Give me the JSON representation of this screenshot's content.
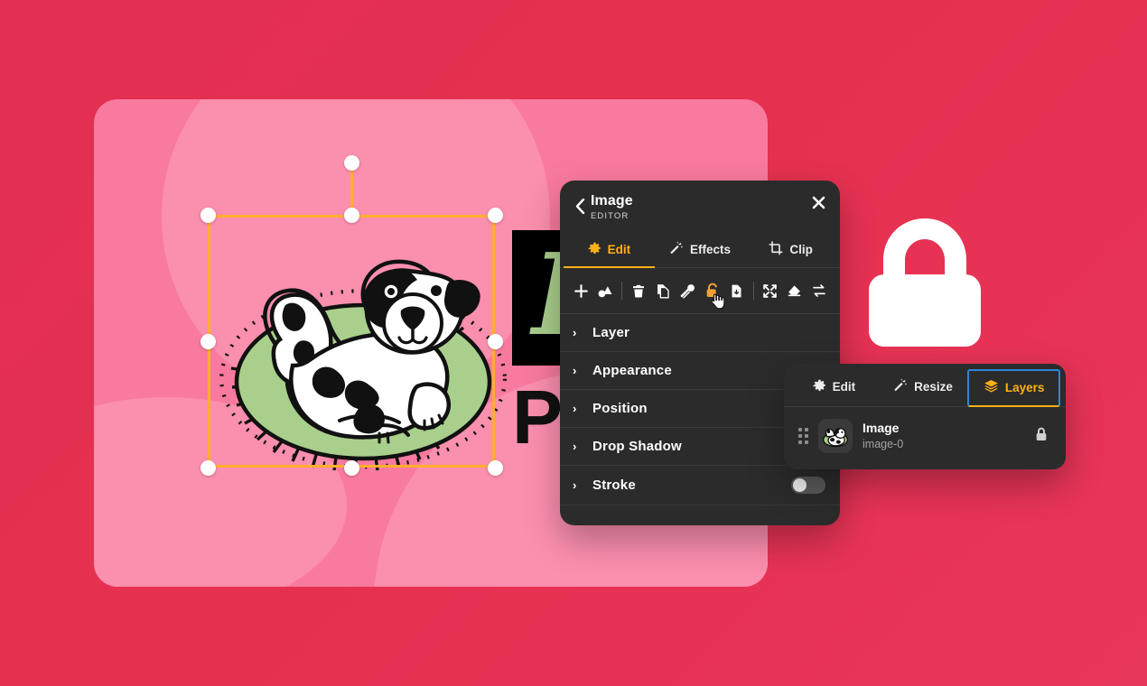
{
  "colors": {
    "backdrop": "#e6304f",
    "canvas_card": "#f97a9f",
    "canvas_blob": "#fb8fae",
    "panel_bg": "#2b2b2b",
    "accent_orange": "#ffb114",
    "selection_orange": "#ffae2e",
    "focus_blue": "#2e86d8",
    "rug_green": "#a9cf8c",
    "lock_white": "#ffffff"
  },
  "canvas": {
    "logo_letter": "B",
    "logo_subletter": "P",
    "artwork_name": "dog-on-rug-illustration"
  },
  "editor": {
    "title": "Image",
    "subtitle": "EDITOR",
    "back_icon": "chevron-left-icon",
    "close_icon": "close-icon",
    "tabs": [
      {
        "label": "Edit",
        "icon": "gear-icon",
        "active": true
      },
      {
        "label": "Effects",
        "icon": "magic-wand-icon",
        "active": false
      },
      {
        "label": "Clip",
        "icon": "crop-icon",
        "active": false
      }
    ],
    "toolbar": [
      {
        "name": "add-icon",
        "title": "Add"
      },
      {
        "name": "shapes-icon",
        "title": "Shapes"
      },
      {
        "name": "divider-1",
        "title": ""
      },
      {
        "name": "trash-icon",
        "title": "Delete"
      },
      {
        "name": "duplicate-icon",
        "title": "Duplicate"
      },
      {
        "name": "eyedropper-icon",
        "title": "Eyedropper"
      },
      {
        "name": "unlock-icon",
        "title": "Lock"
      },
      {
        "name": "download-icon",
        "title": "Download"
      },
      {
        "name": "divider-2",
        "title": ""
      },
      {
        "name": "resize-icon",
        "title": "Resize"
      },
      {
        "name": "eraser-icon",
        "title": "Eraser"
      },
      {
        "name": "replace-icon",
        "title": "Replace"
      }
    ],
    "sections": [
      {
        "label": "Layer",
        "expanded": false,
        "toggle": null
      },
      {
        "label": "Appearance",
        "expanded": false,
        "toggle": null
      },
      {
        "label": "Position",
        "expanded": false,
        "toggle": null
      },
      {
        "label": "Drop Shadow",
        "expanded": false,
        "toggle": null
      },
      {
        "label": "Stroke",
        "expanded": false,
        "toggle": "off"
      }
    ]
  },
  "layers_panel": {
    "tabs": [
      {
        "label": "Edit",
        "icon": "gear-icon",
        "active": false
      },
      {
        "label": "Resize",
        "icon": "magic-wand-icon",
        "active": false
      },
      {
        "label": "Layers",
        "icon": "layers-icon",
        "active": true
      }
    ],
    "layers": [
      {
        "name": "Image",
        "id": "image-0",
        "locked": true,
        "drag_handle": "drag-handle-icon",
        "lock_icon": "lock-closed-icon"
      }
    ]
  },
  "decorative": {
    "big_lock_icon": "lock-closed-icon"
  }
}
